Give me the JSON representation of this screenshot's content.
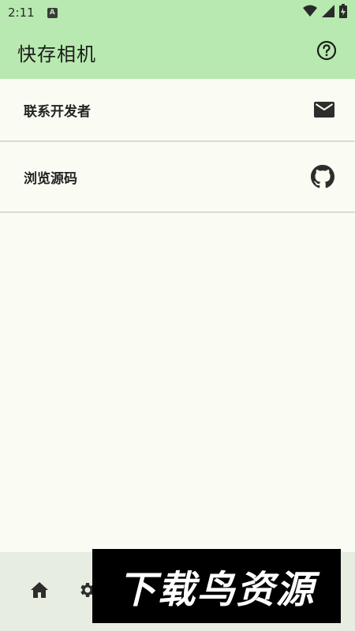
{
  "status_bar": {
    "time": "2:11",
    "notif_letter": "A",
    "icons": [
      "wifi-icon",
      "signal-icon",
      "battery-icon"
    ]
  },
  "app_bar": {
    "title": "快存相机",
    "help_icon": "help-circle-icon"
  },
  "list": {
    "items": [
      {
        "label": "联系开发者",
        "icon": "mail-icon"
      },
      {
        "label": "浏览源码",
        "icon": "github-icon"
      }
    ]
  },
  "bottom_nav": {
    "items": [
      {
        "icon": "home-icon"
      },
      {
        "icon": "settings-icon"
      }
    ]
  },
  "watermark": {
    "text": "下载鸟资源"
  },
  "colors": {
    "app_bar_bg": "#b8e9b0",
    "page_bg": "#fafcf3",
    "bottom_nav_bg": "#e8ede1",
    "divider": "#d9dbd3"
  }
}
